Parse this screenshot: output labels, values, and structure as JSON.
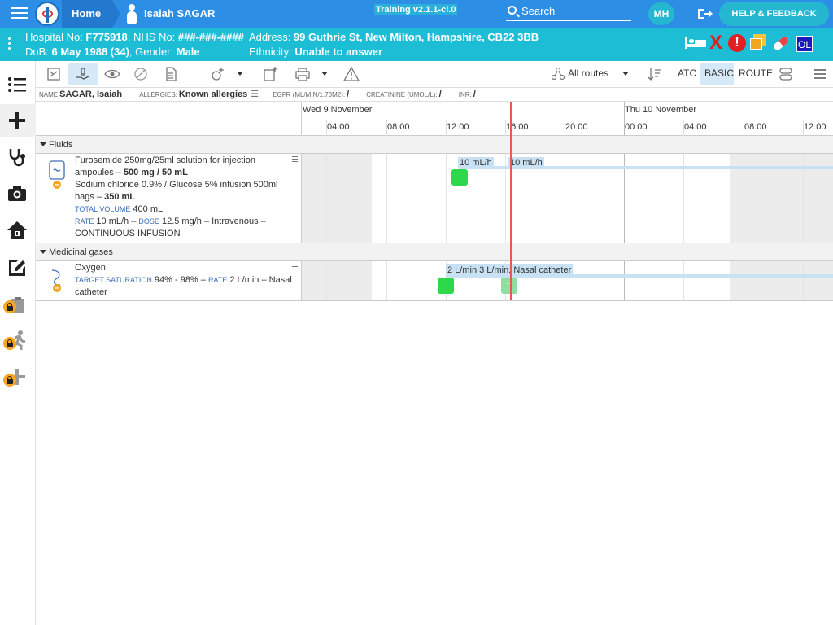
{
  "header": {
    "home_label": "Home",
    "patient_name": "Isaiah SAGAR",
    "version": "Training v2.1.1-ci.0",
    "search_placeholder": "Search",
    "user_initials": "MH",
    "help_label": "HELP & FEEDBACK"
  },
  "banner": {
    "hospital_label": "Hospital No: ",
    "hospital_no": "F775918",
    "nhs_label": ", NHS No: ",
    "nhs_no": "###-###-####",
    "dob_label": "DoB: ",
    "dob": "6 May 1988 (34)",
    "gender_label": ", Gender: ",
    "gender": "Male",
    "address_label": "Address: ",
    "address": "99 Guthrie St, New Milton, Hampshire, CB22 3BB",
    "ethnicity_label": "Ethnicity: ",
    "ethnicity": "Unable to answer",
    "x_glyph": "X",
    "alert_glyph": "!",
    "ol_label": "OL"
  },
  "toolbar": {
    "routes_label": "All routes",
    "atc_label": "ATC",
    "basic_label": "BASIC",
    "route_label": "ROUTE"
  },
  "info": {
    "name_key": "NAME",
    "name": "SAGAR, Isaiah",
    "allergies_key": "ALLERGIES:",
    "allergies": "Known allergies",
    "egfr_key": "EGFR (ML/MIN/1.73M2):",
    "egfr": "/",
    "creatinine_key": "CREATININE (UMOL/L):",
    "creatinine": "/",
    "inr_key": "INR:",
    "inr": "/"
  },
  "timeline": {
    "day1": "Wed 9 November",
    "day2": "Thu 10 November",
    "hours": [
      "04:00",
      "08:00",
      "12:00",
      "16:00",
      "20:00",
      "00:00",
      "04:00",
      "08:00",
      "12:00"
    ]
  },
  "sections": {
    "fluids": "Fluids",
    "gases": "Medicinal gases"
  },
  "fluid_row": {
    "line1": "Furosemide 250mg/25ml solution for injection ampoules",
    "dash1": " – ",
    "dose1": "500 mg / 50 mL",
    "line2": "Sodium chloride 0.9% / Glucose 5% infusion 500ml bags",
    "dash2": " – ",
    "dose2": "350 mL",
    "total_volume_key": "TOTAL VOLUME",
    "total_volume": " 400 mL",
    "rate_key": "RATE",
    "rate": " 10 mL/h – ",
    "dose_key": "DOSE",
    "dose": " 12.5 mg/h – Intravenous – CONTINUOUS INFUSION",
    "label_a": "10 mL/h",
    "label_b": "10 mL/h"
  },
  "oxygen_row": {
    "name": "Oxygen",
    "target_key": "TARGET SATURATION",
    "target": " 94% - 98% – ",
    "rate_key": "RATE",
    "rate": " 2 L/min – Nasal catheter",
    "label": "2 L/min 3 L/min, Nasal catheter"
  },
  "colors": {
    "topbar": "#2d8ee6",
    "banner": "#1ebdd6",
    "admin_done": "#2ed84b",
    "now_line": "#e55555"
  }
}
